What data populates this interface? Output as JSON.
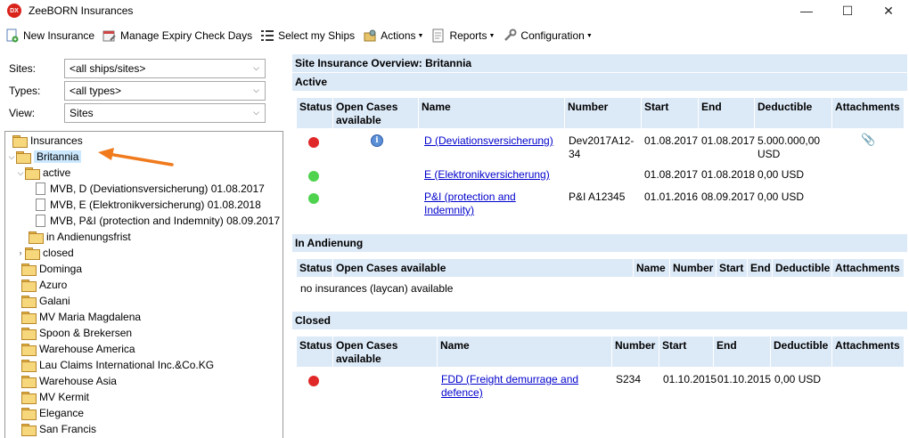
{
  "window": {
    "app_icon_text": "DX",
    "title": "ZeeBORN Insurances",
    "minimize": "—",
    "maximize": "☐",
    "close": "✕"
  },
  "toolbar": {
    "new_insurance": "New Insurance",
    "manage_expiry": "Manage Expiry Check Days",
    "select_ships": "Select my Ships",
    "actions": "Actions",
    "reports": "Reports",
    "configuration": "Configuration"
  },
  "filters": {
    "sites_label": "Sites:",
    "sites_value": "<all ships/sites>",
    "types_label": "Types:",
    "types_value": "<all types>",
    "view_label": "View:",
    "view_value": "Sites"
  },
  "tree": {
    "root": "Insurances",
    "selected": "Britannia",
    "active": "active",
    "docs": [
      "MVB, D (Deviationsversicherung) 01.08.2017",
      "MVB, E (Elektronikversicherung) 01.08.2018",
      "MVB, P&I (protection and Indemnity) 08.09.2017"
    ],
    "in_andienung": "in Andienungsfrist",
    "closed": "closed",
    "sites": [
      "Dominga",
      "Azuro",
      "Galani",
      "MV Maria Magdalena",
      "Spoon & Brekersen",
      "Warehouse America",
      "Lau Claims International Inc.&Co.KG",
      "Warehouse Asia",
      "MV Kermit",
      "Elegance",
      "San Francis"
    ]
  },
  "overview": {
    "title": "Site Insurance Overview: Britannia",
    "active_title": "Active",
    "andienung_title": "In Andienung",
    "closed_title": "Closed",
    "headers": {
      "status": "Status",
      "open_cases_1": "Open Cases",
      "open_cases_2": "available",
      "open_cases_full": "Open Cases available",
      "name": "Name",
      "number": "Number",
      "start": "Start",
      "end": "End",
      "deductible": "Deductible",
      "attachments": "Attachments"
    },
    "active_rows": [
      {
        "status": "red",
        "info": "i",
        "name_1": "D (Deviationsversicherung)",
        "name_2": "",
        "number_1": "Dev2017A12-",
        "number_2": "34",
        "start": "01.08.2017",
        "end": "01.08.2017",
        "ded_1": "5.000.000,00",
        "ded_2": "USD",
        "attachment": "📎"
      },
      {
        "status": "green",
        "name_1": "E (Elektronikversicherung)",
        "name_2": "",
        "number_1": "",
        "number_2": "",
        "start": "01.08.2017",
        "end": "01.08.2018",
        "ded_1": "0,00 USD",
        "ded_2": ""
      },
      {
        "status": "green",
        "name_1": "P&I (protection and",
        "name_2": "Indemnity)",
        "number_1": "P&I A12345",
        "number_2": "",
        "start": "01.01.2016",
        "end": "08.09.2017",
        "ded_1": "0,00 USD",
        "ded_2": ""
      }
    ],
    "andienung_empty": "no insurances (laycan) available",
    "closed_rows": [
      {
        "status": "red",
        "name_1": "FDD (Freight demurrage and",
        "name_2": "defence)",
        "number": "S234",
        "start": "01.10.2015",
        "end": "01.10.2015",
        "deductible": "0,00 USD"
      }
    ]
  },
  "colors": {
    "header_bg": "#dce9f7",
    "selection": "#cce8ff",
    "link": "#0000cc",
    "status_red": "#e02828",
    "status_green": "#4fd34f",
    "arrow": "#f07a1c"
  }
}
